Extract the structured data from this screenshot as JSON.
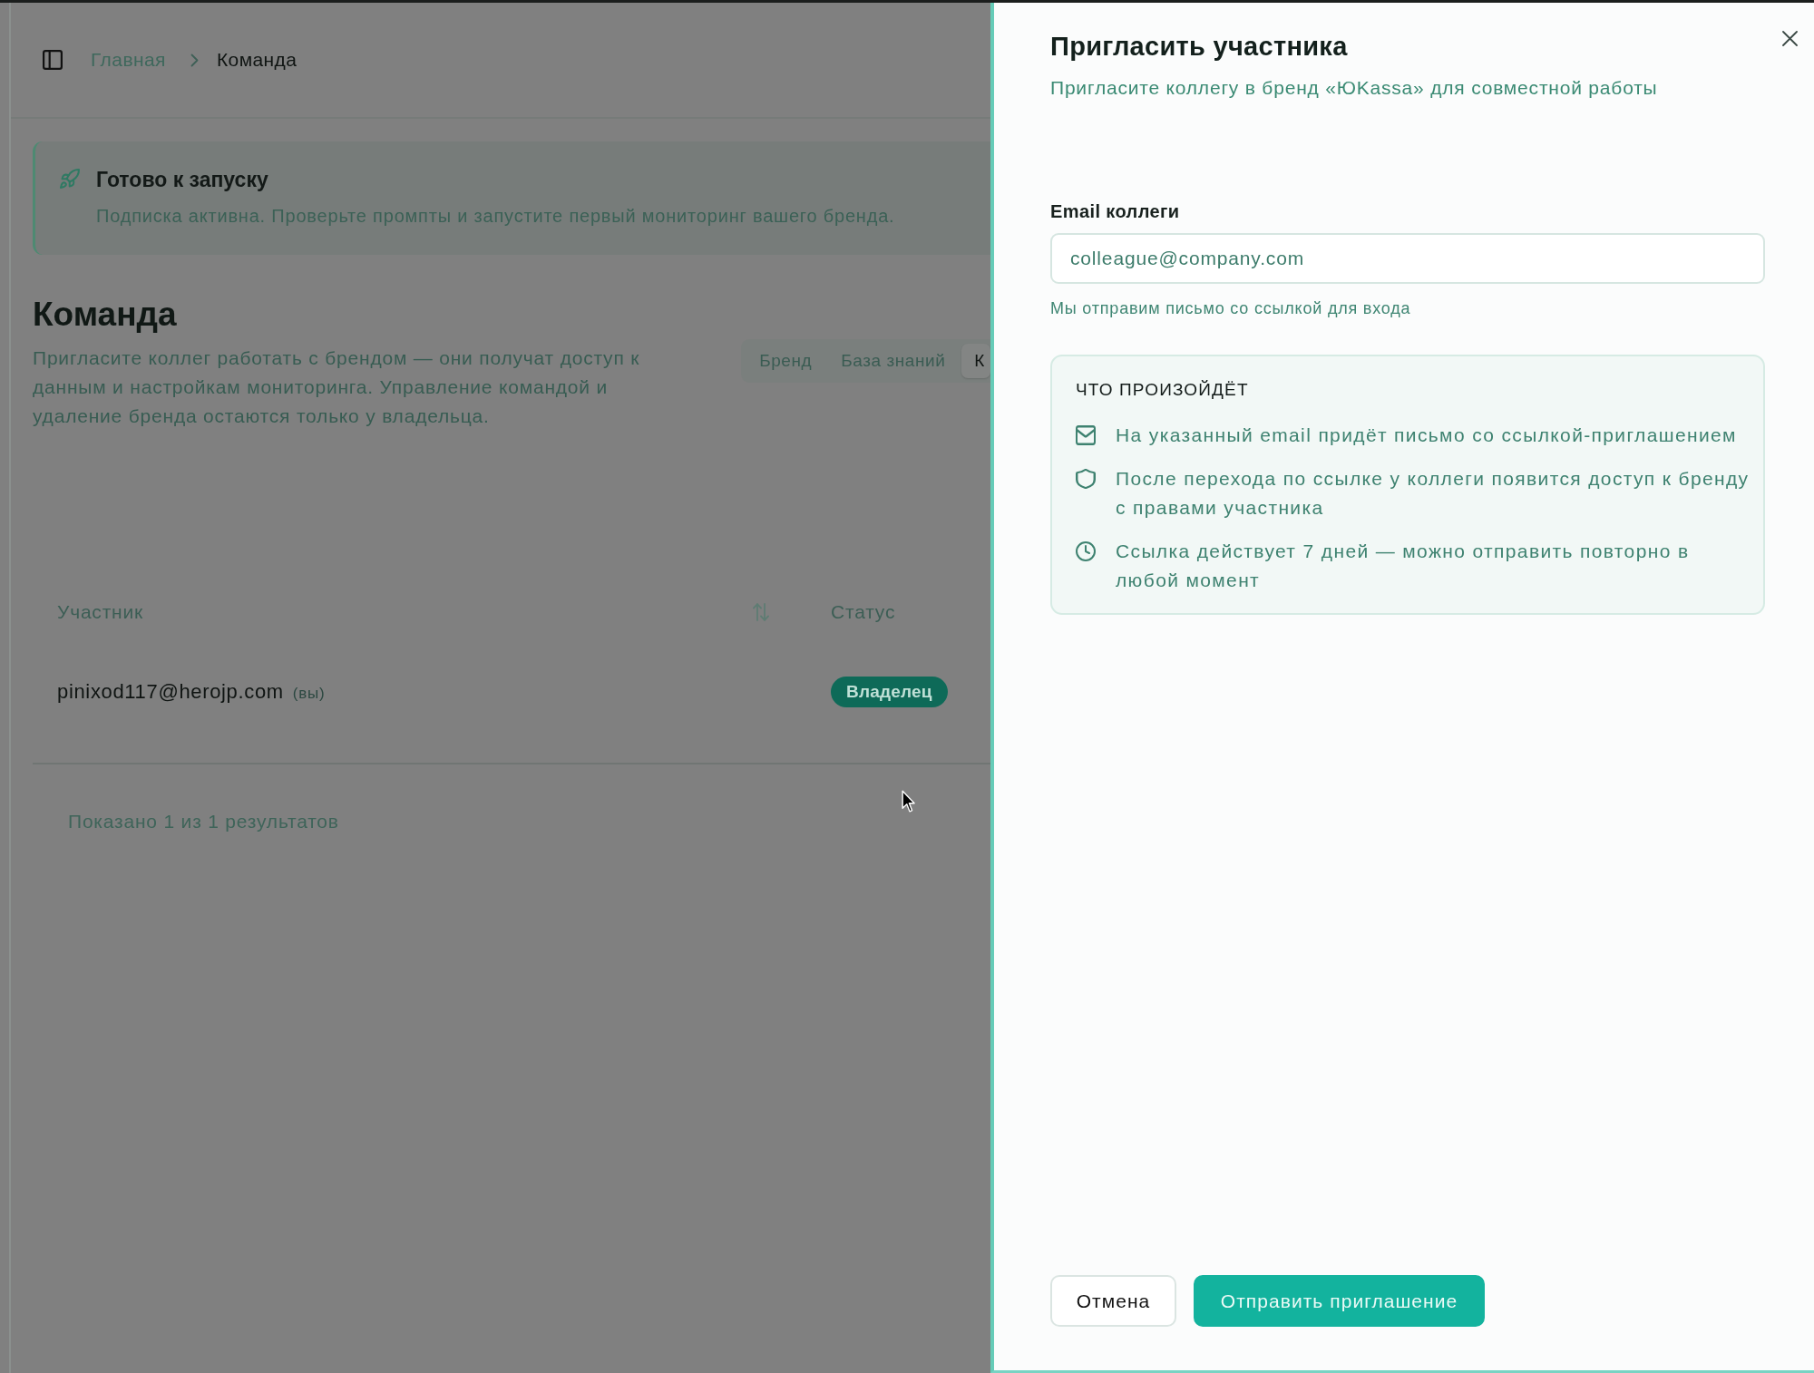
{
  "breadcrumb": [
    {
      "label": "Главная",
      "current": false
    },
    {
      "label": "Команда",
      "current": true
    }
  ],
  "banner": {
    "title": "Готово к запуску",
    "text": "Подписка активна. Проверьте промпты и запустите первый мониторинг вашего бренда."
  },
  "page": {
    "title": "Команда",
    "description": "Пригласите коллег работать с брендом — они получат доступ к данным и настройкам мониторинга. Управление командой и удаление бренда остаются только у владельца."
  },
  "tabs": [
    {
      "label": "Бренд",
      "selected": false
    },
    {
      "label": "База знаний",
      "selected": false
    },
    {
      "label": "К",
      "selected": true
    }
  ],
  "table": {
    "columns": [
      {
        "label": "Участник",
        "sortable": true
      },
      {
        "label": "Статус",
        "sortable": false
      }
    ],
    "rows": [
      {
        "member": "pinixod117@herojp.com",
        "note": "(вы)",
        "status": "Владелец"
      }
    ],
    "footer": "Показано 1 из 1 результатов"
  },
  "dialog": {
    "title": "Пригласить участника",
    "subtitle": "Пригласите коллегу в бренд «ЮKassa» для совместной работы",
    "field": {
      "label": "Email коллеги",
      "placeholder": "colleague@company.com",
      "hint": "Мы отправим письмо со ссылкой для входа"
    },
    "info": {
      "title": "ЧТО ПРОИЗОЙДЁТ",
      "items": [
        "На указанный email придёт письмо со ссылкой-приглашением",
        "После перехода по ссылке у коллеги появится доступ к бренду с правами участника",
        "Ссылка действует 7 дней — можно отправить повторно в любой момент"
      ]
    },
    "buttons": [
      {
        "label": "Отмена",
        "kind": "secondary"
      },
      {
        "label": "Отправить приглашение",
        "kind": "primary"
      }
    ]
  }
}
